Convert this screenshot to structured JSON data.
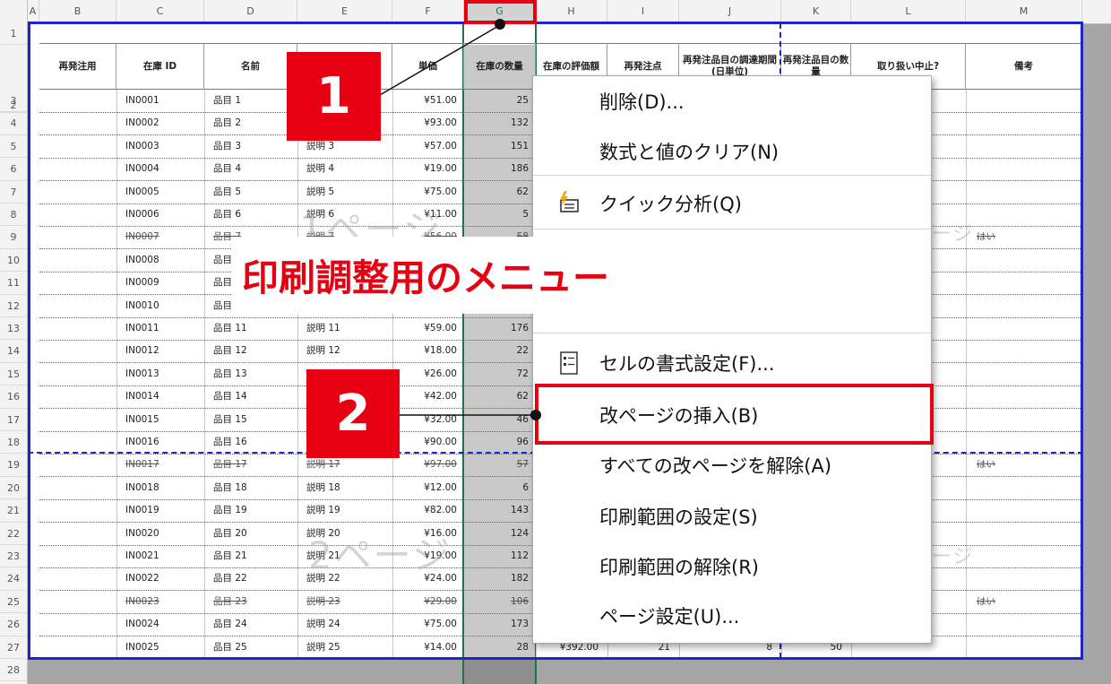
{
  "columns": [
    "A",
    "B",
    "C",
    "D",
    "E",
    "F",
    "G",
    "H",
    "I",
    "J",
    "K",
    "L",
    "M"
  ],
  "selected_column": "G",
  "rows": [
    "1",
    "2",
    "3",
    "4",
    "5",
    "6",
    "7",
    "8",
    "9",
    "10",
    "11",
    "12",
    "13",
    "14",
    "15",
    "16",
    "17",
    "18",
    "19",
    "20",
    "21",
    "22",
    "23",
    "24",
    "25",
    "26",
    "27",
    "28"
  ],
  "table_headers": [
    "再発注用",
    "在庫 ID",
    "名前",
    "",
    "単価",
    "在庫の数量",
    "在庫の評価額",
    "再発注点",
    "再発注品目の調達期間 (日単位)",
    "再発注品目の数量",
    "取り扱い中止?",
    "備考"
  ],
  "data_rows": [
    {
      "id": "IN0001",
      "name": "品目 1",
      "desc": "",
      "price": "¥51.00",
      "qty": "25",
      "strike": false
    },
    {
      "id": "IN0002",
      "name": "品目 2",
      "desc": "",
      "price": "¥93.00",
      "qty": "132",
      "strike": false
    },
    {
      "id": "IN0003",
      "name": "品目 3",
      "desc": "説明 3",
      "price": "¥57.00",
      "qty": "151",
      "strike": false
    },
    {
      "id": "IN0004",
      "name": "品目 4",
      "desc": "説明 4",
      "price": "¥19.00",
      "qty": "186",
      "strike": false
    },
    {
      "id": "IN0005",
      "name": "品目 5",
      "desc": "説明 5",
      "price": "¥75.00",
      "qty": "62",
      "strike": false
    },
    {
      "id": "IN0006",
      "name": "品目 6",
      "desc": "説明 6",
      "price": "¥11.00",
      "qty": "5",
      "strike": false
    },
    {
      "id": "IN0007",
      "name": "品目 7",
      "desc": "説明 7",
      "price": "¥56.00",
      "qty": "58",
      "strike": true
    },
    {
      "id": "IN0008",
      "name": "品目",
      "desc": "",
      "price": "",
      "qty": "",
      "strike": false
    },
    {
      "id": "IN0009",
      "name": "品目",
      "desc": "",
      "price": "",
      "qty": "",
      "strike": false
    },
    {
      "id": "IN0010",
      "name": "品目",
      "desc": "",
      "price": "",
      "qty": "",
      "strike": false
    },
    {
      "id": "IN0011",
      "name": "品目 11",
      "desc": "説明 11",
      "price": "¥59.00",
      "qty": "176",
      "strike": false
    },
    {
      "id": "IN0012",
      "name": "品目 12",
      "desc": "説明 12",
      "price": "¥18.00",
      "qty": "22",
      "strike": false
    },
    {
      "id": "IN0013",
      "name": "品目 13",
      "desc": "",
      "price": "¥26.00",
      "qty": "72",
      "strike": false
    },
    {
      "id": "IN0014",
      "name": "品目 14",
      "desc": "",
      "price": "¥42.00",
      "qty": "62",
      "strike": false
    },
    {
      "id": "IN0015",
      "name": "品目 15",
      "desc": "",
      "price": "¥32.00",
      "qty": "46",
      "strike": false
    },
    {
      "id": "IN0016",
      "name": "品目 16",
      "desc": "",
      "price": "¥90.00",
      "qty": "96",
      "strike": false
    },
    {
      "id": "IN0017",
      "name": "品目 17",
      "desc": "説明 17",
      "price": "¥97.00",
      "qty": "57",
      "strike": true
    },
    {
      "id": "IN0018",
      "name": "品目 18",
      "desc": "説明 18",
      "price": "¥12.00",
      "qty": "6",
      "strike": false
    },
    {
      "id": "IN0019",
      "name": "品目 19",
      "desc": "説明 19",
      "price": "¥82.00",
      "qty": "143",
      "strike": false
    },
    {
      "id": "IN0020",
      "name": "品目 20",
      "desc": "説明 20",
      "price": "¥16.00",
      "qty": "124",
      "strike": false
    },
    {
      "id": "IN0021",
      "name": "品目 21",
      "desc": "説明 21",
      "price": "¥19.00",
      "qty": "112",
      "strike": false
    },
    {
      "id": "IN0022",
      "name": "品目 22",
      "desc": "説明 22",
      "price": "¥24.00",
      "qty": "182",
      "strike": false
    },
    {
      "id": "IN0023",
      "name": "品目 23",
      "desc": "説明 23",
      "price": "¥29.00",
      "qty": "106",
      "strike": true
    },
    {
      "id": "IN0024",
      "name": "品目 24",
      "desc": "説明 24",
      "price": "¥75.00",
      "qty": "173",
      "strike": false
    },
    {
      "id": "IN0025",
      "name": "品目 25",
      "desc": "説明 25",
      "price": "¥14.00",
      "qty": "28",
      "strike": false
    }
  ],
  "row27_extra": {
    "value": "¥392.00",
    "reorder": "21",
    "days": "8",
    "count": "50"
  },
  "discontinued_label": "はい",
  "watermarks": {
    "page1": "1ページ",
    "page2": "2ページ",
    "right1": "ージ",
    "right2": "ージ"
  },
  "context_menu": {
    "items": [
      {
        "label": "削除(D)...",
        "icon": ""
      },
      {
        "label": "数式と値のクリア(N)",
        "icon": ""
      },
      {
        "label": "クイック分析(Q)",
        "icon": "quick-analysis-icon"
      },
      {
        "label": "セルの書式設定(F)...",
        "icon": "format-cells-icon"
      },
      {
        "label": "改ページの挿入(B)",
        "icon": ""
      },
      {
        "label": "すべての改ページを解除(A)",
        "icon": ""
      },
      {
        "label": "印刷範囲の設定(S)",
        "icon": ""
      },
      {
        "label": "印刷範囲の解除(R)",
        "icon": ""
      },
      {
        "label": "ページ設定(U)...",
        "icon": ""
      }
    ]
  },
  "annotations": {
    "step1": "1",
    "step2": "2",
    "banner": "印刷調整用のメニュー"
  },
  "colors": {
    "accent_red": "#e60012",
    "page_break_blue": "#1f25c6",
    "excel_green": "#217346"
  }
}
